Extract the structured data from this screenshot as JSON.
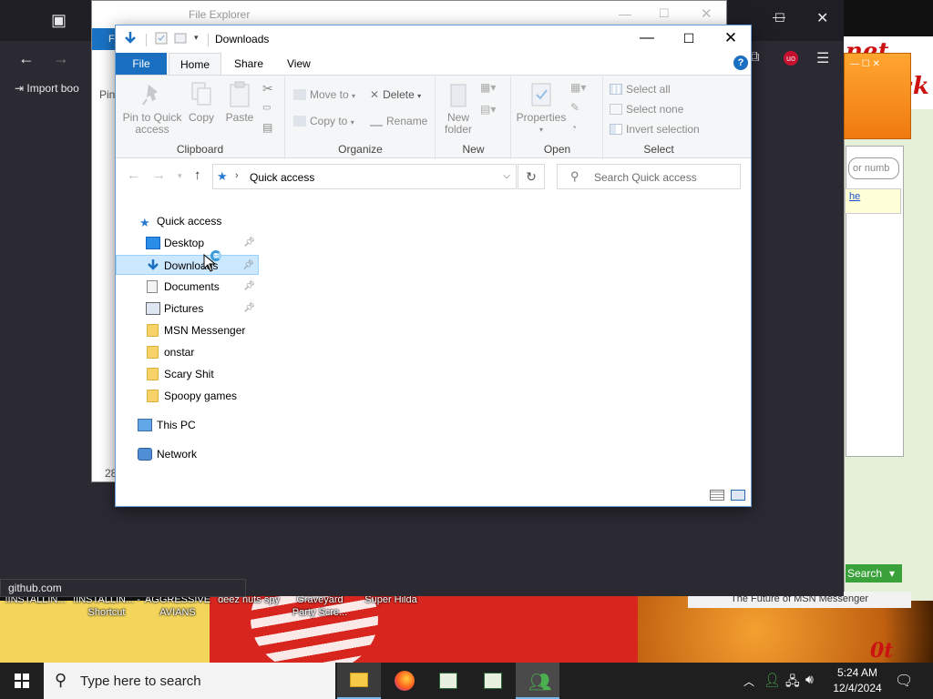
{
  "browser": {
    "bookmark_label": "Import boo",
    "status_url": "github.com",
    "side_partial": "Pin",
    "bottom_partial": "28"
  },
  "explorer_back": {
    "title": "File Explorer",
    "ribbon_partial": "F"
  },
  "explorer": {
    "title": "Downloads",
    "tabs": [
      "File",
      "Home",
      "Share",
      "View"
    ],
    "ribbon": {
      "clipboard": {
        "label": "Clipboard",
        "pin_to_quick_access": "Pin to Quick access",
        "copy": "Copy",
        "paste": "Paste"
      },
      "organize": {
        "label": "Organize",
        "move_to": "Move to",
        "copy_to": "Copy to",
        "delete": "Delete",
        "rename": "Rename"
      },
      "new": {
        "label": "New",
        "new_folder": "New folder"
      },
      "open": {
        "label": "Open",
        "properties": "Properties"
      },
      "select": {
        "label": "Select",
        "select_all": "Select all",
        "select_none": "Select none",
        "invert_selection": "Invert selection"
      }
    },
    "address": {
      "path": "Quick access",
      "search_placeholder": "Search Quick access"
    },
    "nav": {
      "quick_access": "Quick access",
      "pinned": [
        "Desktop",
        "Downloads",
        "Documents",
        "Pictures"
      ],
      "folders": [
        "MSN Messenger",
        "onstar",
        "Scary Shit",
        "Spoopy games"
      ],
      "this_pc": "This PC",
      "network": "Network"
    }
  },
  "msn": {
    "search_label": "Search",
    "footer": "The Future of MSN Messenger",
    "field_partial": "or numb",
    "link_partial": "he"
  },
  "wallpaper": {
    "red_text_1": "net shit",
    "red_text_2": "ck",
    "red_text_3": "0t"
  },
  "desktop_icons": [
    {
      "label": "!INSTALLIN..."
    },
    {
      "label": "!INSTALLIN... - Shortcut"
    },
    {
      "label": "AGGRESSIVE AVIANS"
    },
    {
      "label": "deez nuts spy"
    },
    {
      "label": "Graveyard Party Scre..."
    },
    {
      "label": "Super Hilda"
    }
  ],
  "taskbar": {
    "search_placeholder": "Type here to search",
    "time": "5:24 AM",
    "date": "12/4/2024"
  },
  "colors": {
    "accent": "#1a6fc1",
    "selection": "#cce8ff",
    "taskbar": "#1f1f1f"
  }
}
